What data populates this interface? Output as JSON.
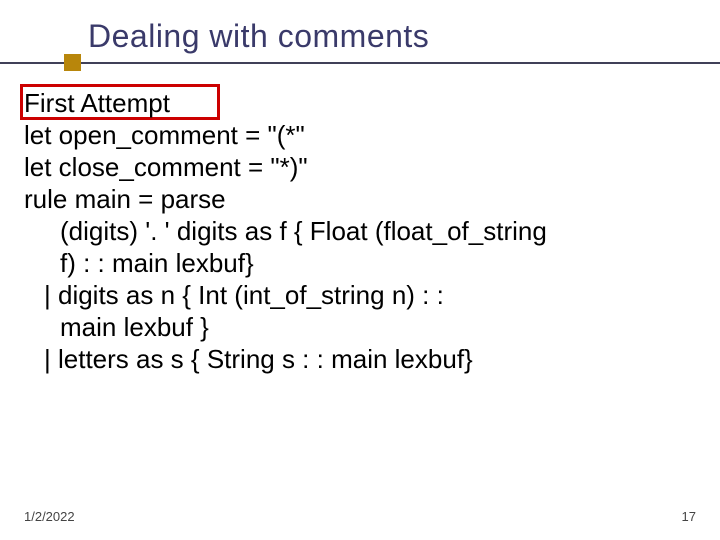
{
  "slide": {
    "title": "Dealing with comments",
    "date": "1/2/2022",
    "page_number": "17"
  },
  "body": {
    "l1": "First Attempt",
    "l2": "let open_comment = \"(*\"",
    "l3": "let close_comment = \"*)\"",
    "l4": "rule main = parse",
    "l5": "(digits) '. ' digits as f { Float (float_of_string",
    "l6": "f) : : main lexbuf}",
    "l7": "| digits as n          { Int (int_of_string n) : :",
    "l8": "main lexbuf }",
    "l9": "| letters as s         { String s : : main lexbuf}"
  }
}
